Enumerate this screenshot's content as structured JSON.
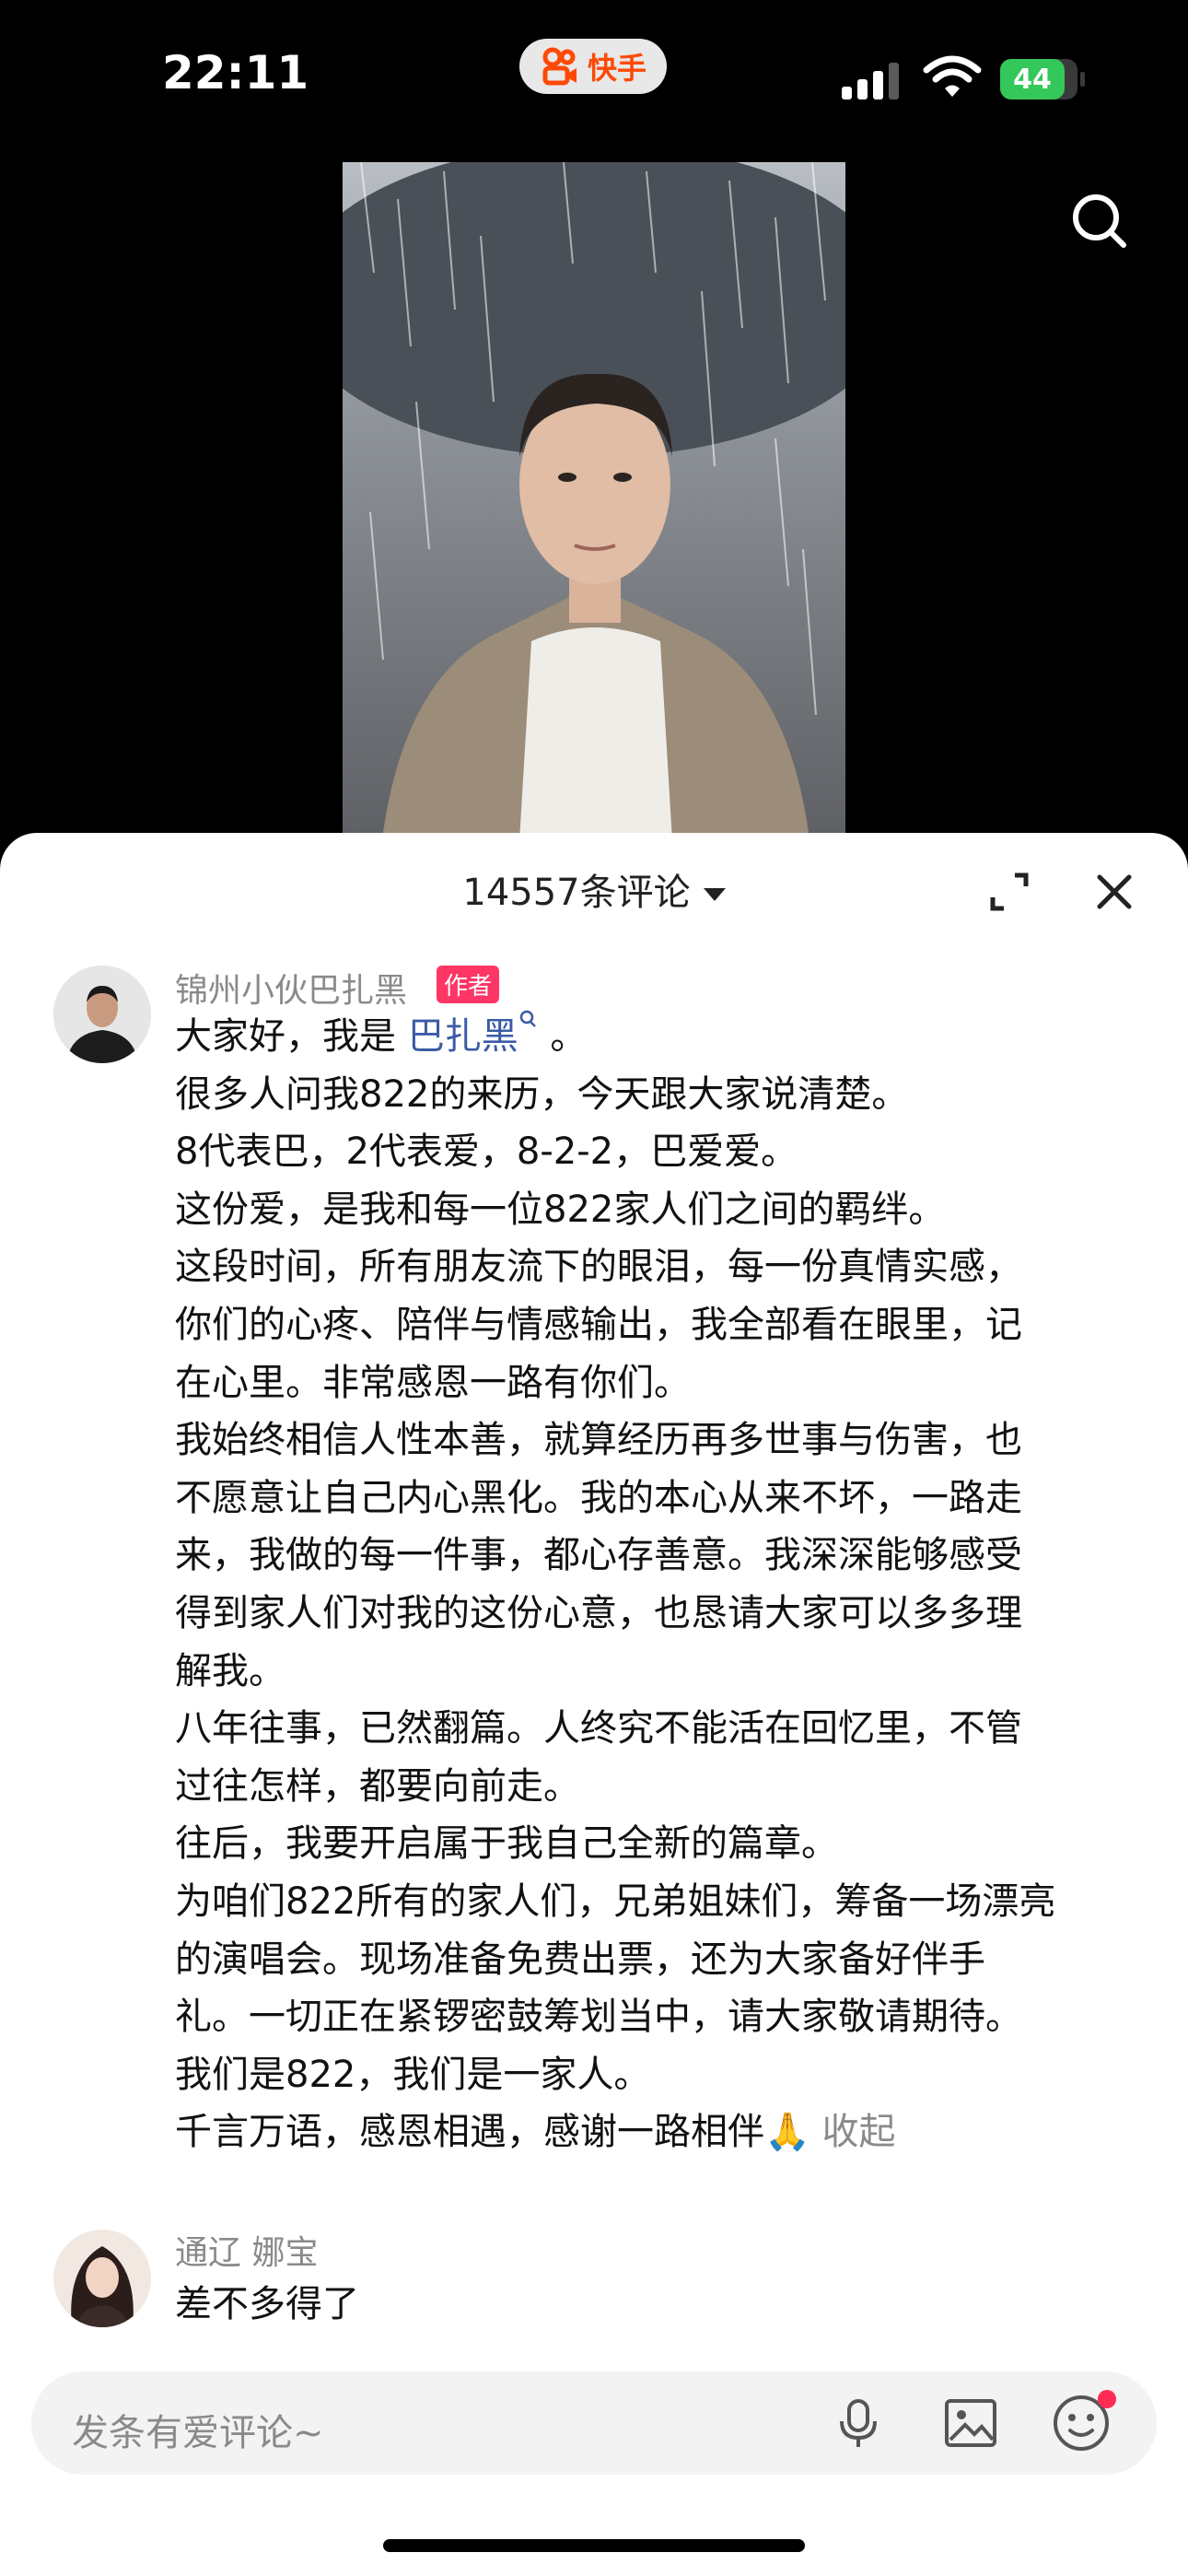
{
  "status_bar": {
    "time": "22:11",
    "app_badge": "快手",
    "battery": "44"
  },
  "sheet": {
    "comment_count": "14557条评论",
    "comments": [
      {
        "username": "锦州小伙巴扎黑",
        "badge": "作者",
        "lines": [
          {
            "pre": "大家好，我是 ",
            "mention": "巴扎黑",
            "post": " 。"
          },
          {
            "text": "很多人问我822的来历，今天跟大家说清楚。"
          },
          {
            "text": "8代表巴，2代表爱，8-2-2，巴爱爱。"
          },
          {
            "text": "这份爱，是我和每一位822家人们之间的羁绊。"
          },
          {
            "text": "这段时间，所有朋友流下的眼泪，每一份真情实感，"
          },
          {
            "text": "你们的心疼、陪伴与情感输出，我全部看在眼里，记"
          },
          {
            "text": "在心里。非常感恩一路有你们。"
          },
          {
            "text": "我始终相信人性本善，就算经历再多世事与伤害，也"
          },
          {
            "text": "不愿意让自己内心黑化。我的本心从来不坏，一路走"
          },
          {
            "text": "来，我做的每一件事，都心存善意。我深深能够感受"
          },
          {
            "text": "得到家人们对我的这份心意，也恳请大家可以多多理"
          },
          {
            "text": "解我。"
          },
          {
            "text": "八年往事，已然翻篇。人终究不能活在回忆里，不管"
          },
          {
            "text": "过往怎样，都要向前走。"
          },
          {
            "text": "往后，我要开启属于我自己全新的篇章。"
          },
          {
            "text": "为咱们822所有的家人们，兄弟姐妹们，筹备一场漂亮"
          },
          {
            "text": "的演唱会。现场准备免费出票，还为大家备好伴手"
          },
          {
            "text": "礼。一切正在紧锣密鼓筹划当中，请大家敬请期待。"
          },
          {
            "text": "我们是822，我们是一家人。"
          },
          {
            "pre": "千言万语，感恩相遇，感谢一路相伴🙏 ",
            "collapse": "收起"
          }
        ]
      },
      {
        "username": "通辽 娜宝",
        "text": "差不多得了"
      }
    ]
  },
  "input": {
    "placeholder": "发条有爱评论~"
  }
}
